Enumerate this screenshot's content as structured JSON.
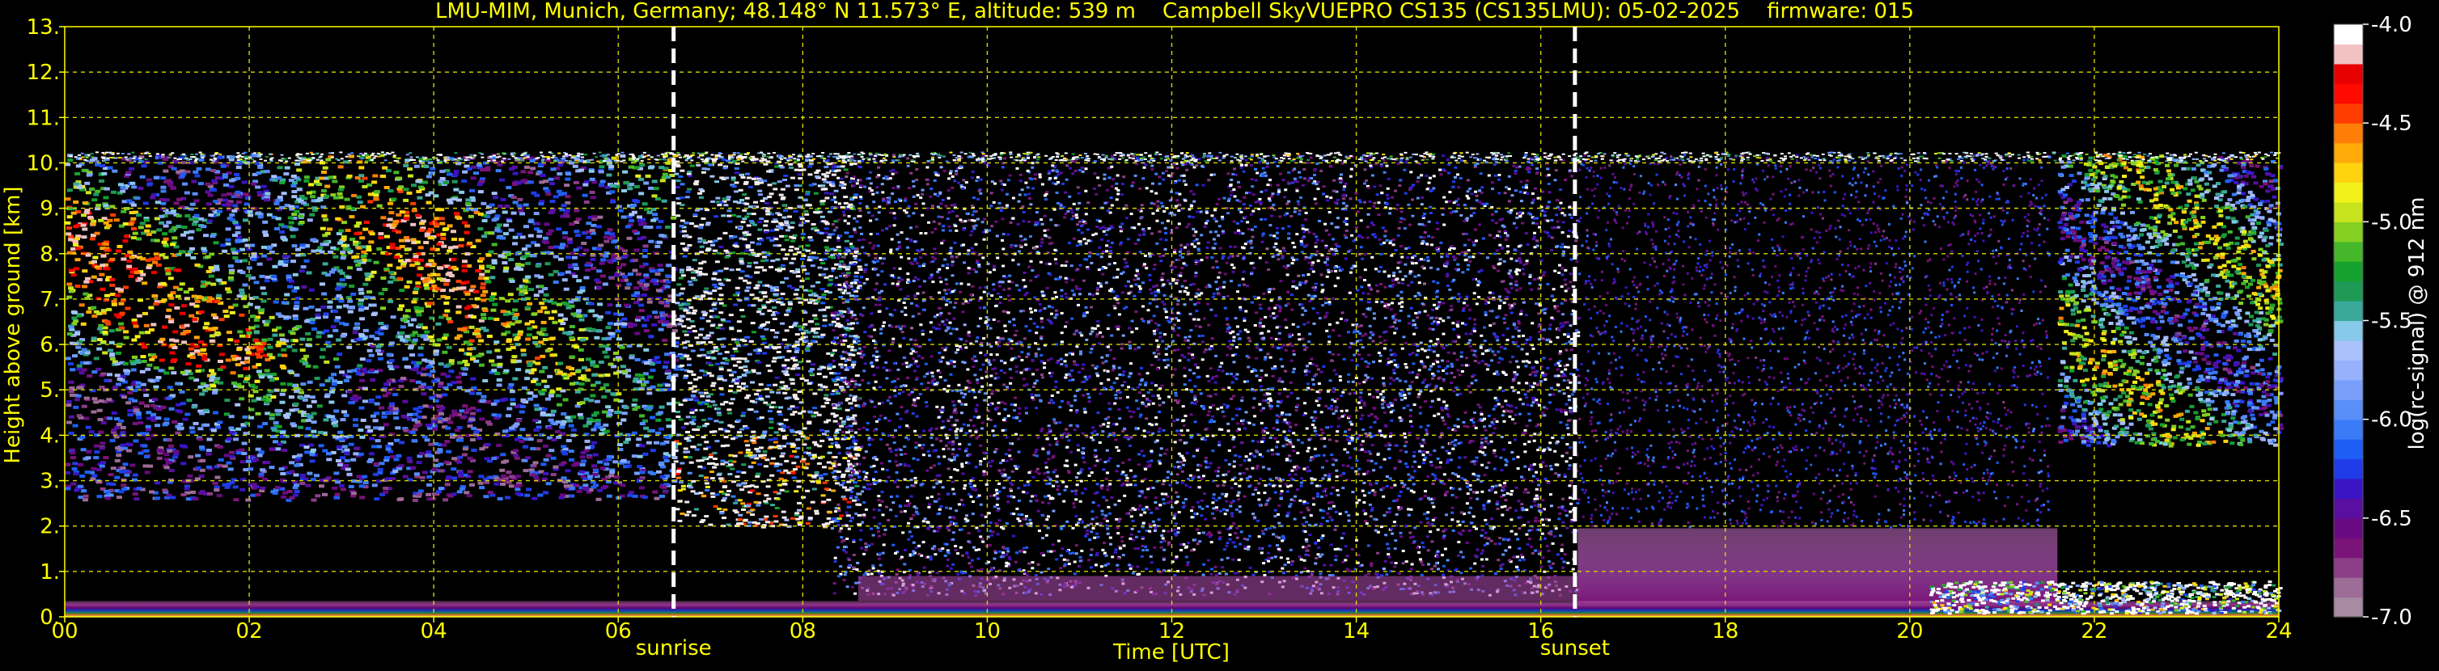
{
  "chart_data": {
    "type": "heatmap",
    "title": "LMU-MIM, Munich, Germany; 48.148° N 11.573° E, altitude: 539 m    Campbell SkyVUEPRO CS135 (CS135LMU): 05-02-2025    firmware: 015",
    "xlabel": "Time [UTC]",
    "ylabel": "Height above ground [km]",
    "xlim": [
      0,
      24
    ],
    "ylim": [
      0,
      13
    ],
    "x_ticks": [
      "00",
      "02",
      "04",
      "06",
      "08",
      "10",
      "12",
      "14",
      "16",
      "18",
      "20",
      "22",
      "24"
    ],
    "y_ticks": [
      "0.",
      "1.",
      "2.",
      "3.",
      "4.",
      "5.",
      "6.",
      "7.",
      "8.",
      "9.",
      "10.",
      "11.",
      "12.",
      "13."
    ],
    "grid": true,
    "markers": [
      {
        "label": "sunrise",
        "x": 6.6
      },
      {
        "label": "sunset",
        "x": 16.37
      }
    ],
    "colorbar": {
      "label": "log(rc-signal) @ 912 nm",
      "range": [
        -7.0,
        -4.0
      ],
      "ticks": [
        "-4.0",
        "-4.5",
        "-5.0",
        "-5.5",
        "-6.0",
        "-6.5",
        "-7.0"
      ],
      "colors": [
        "#a88aa2",
        "#9d6c97",
        "#8a3f86",
        "#7a1478",
        "#6a0a82",
        "#5a0fa0",
        "#3b14c4",
        "#1f3ce8",
        "#1e5ef5",
        "#3a7cf8",
        "#5a8ffa",
        "#7a9ffb",
        "#97b1fc",
        "#a9c1fb",
        "#86c9e8",
        "#3aa89a",
        "#1e9a56",
        "#16a02e",
        "#44b82a",
        "#86d023",
        "#c8e41e",
        "#f2f21a",
        "#ffd40f",
        "#ffaa08",
        "#ff7e05",
        "#ff3c00",
        "#ff0a00",
        "#e80000",
        "#f2c2c2",
        "#ffffff"
      ]
    }
  }
}
